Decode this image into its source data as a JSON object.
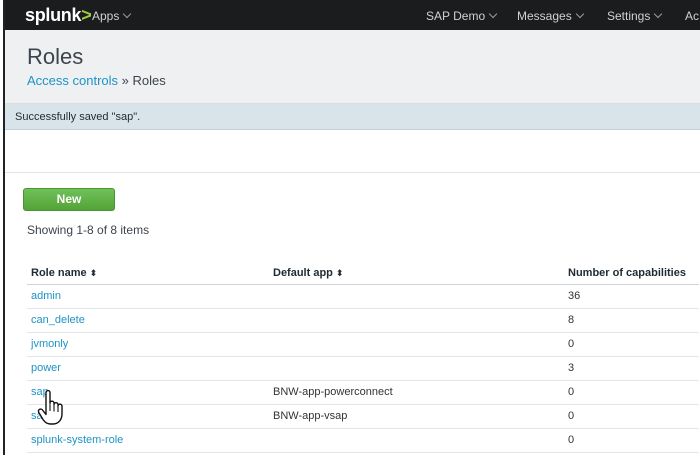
{
  "topbar": {
    "logo_text": "splunk",
    "logo_suffix": ">",
    "apps_label": "Apps",
    "app_context": "SAP Demo",
    "messages_label": "Messages",
    "settings_label": "Settings",
    "activity_label": "Ac"
  },
  "header": {
    "title": "Roles",
    "breadcrumb_link": "Access controls",
    "breadcrumb_sep": " » ",
    "breadcrumb_current": "Roles"
  },
  "banner": {
    "message": "Successfully saved \"sap\"."
  },
  "toolbar": {
    "new_label": "New",
    "showing_text": "Showing 1-8 of 8 items"
  },
  "table": {
    "columns": {
      "role_name": "Role name",
      "default_app": "Default app",
      "capabilities": "Number of capabilities"
    },
    "sort_glyph": "⬍",
    "rows": [
      {
        "role": "admin",
        "app": "",
        "caps": "36"
      },
      {
        "role": "can_delete",
        "app": "",
        "caps": "8"
      },
      {
        "role": "jvmonly",
        "app": "",
        "caps": "0"
      },
      {
        "role": "power",
        "app": "",
        "caps": "3"
      },
      {
        "role": "sap",
        "app": "BNW-app-powerconnect",
        "caps": "0"
      },
      {
        "role": "sa",
        "app": "BNW-app-vsap",
        "caps": "0"
      },
      {
        "role": "splunk-system-role",
        "app": "",
        "caps": "0"
      }
    ]
  },
  "colors": {
    "topbar_bg": "#1a1c1e",
    "link": "#1e93c6",
    "new_button": "#5cb85c",
    "banner_bg": "#d9e3ea",
    "header_bg": "#eef0f2"
  },
  "icons": {
    "cursor": "hand-pointer-icon"
  }
}
